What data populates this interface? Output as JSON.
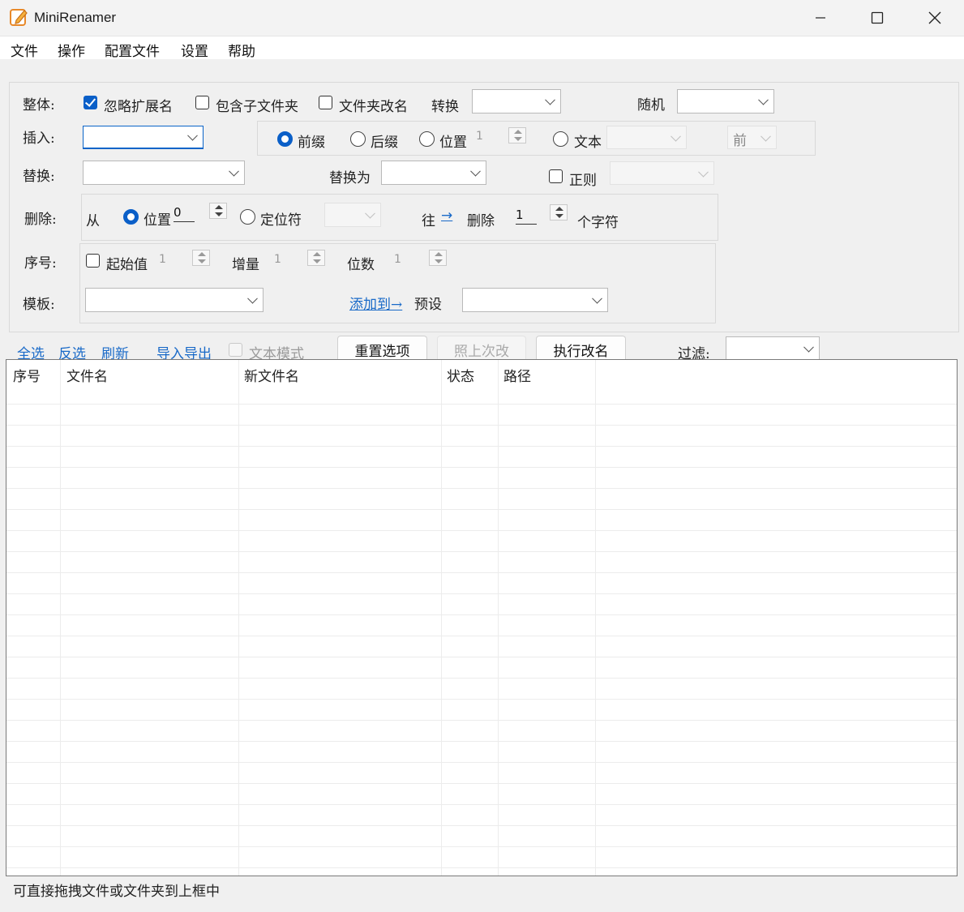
{
  "window": {
    "title": "MiniRenamer",
    "controls": [
      "minimize",
      "maximize",
      "close"
    ]
  },
  "menu": [
    "文件",
    "操作",
    "配置文件",
    "设置",
    "帮助"
  ],
  "options": {
    "whole": {
      "label": "整体:",
      "ignore_ext": {
        "label": "忽略扩展名",
        "checked": true
      },
      "include_subfolders": {
        "label": "包含子文件夹",
        "checked": false
      },
      "rename_folders": {
        "label": "文件夹改名",
        "checked": false
      },
      "convert_label": "转换",
      "convert_value": "",
      "random_label": "随机",
      "random_value": ""
    },
    "insert": {
      "label": "插入:",
      "value": "",
      "prefix_label": "前缀",
      "suffix_label": "后缀",
      "position_label": "位置",
      "position_value": "1",
      "text_label": "文本",
      "text_value": "",
      "side_value": "前",
      "selected": "prefix"
    },
    "replace": {
      "label": "替换:",
      "value": "",
      "replace_with_label": "替换为",
      "replace_with_value": "",
      "regex_label": "正则",
      "regex_checked": false,
      "regex_value": ""
    },
    "delete": {
      "label": "删除:",
      "from_label": "从",
      "position_label": "位置",
      "position_value": "0",
      "locator_label": "定位符",
      "locator_value": "",
      "direction_label": "往",
      "direction_arrow": "→",
      "delete_label": "删除",
      "count_value": "1",
      "chars_label": "个字符"
    },
    "sequence": {
      "label": "序号:",
      "start_label": "起始值",
      "start_checked": false,
      "start_value": "1",
      "increment_label": "增量",
      "increment_value": "1",
      "digits_label": "位数",
      "digits_value": "1"
    },
    "template": {
      "label": "模板:",
      "value": "",
      "add_to_label": "添加到→",
      "preset_label": "预设",
      "preset_value": ""
    }
  },
  "toolbar": {
    "select_all": "全选",
    "invert": "反选",
    "refresh": "刷新",
    "import_export": "导入导出",
    "text_mode": {
      "label": "文本模式",
      "checked": false
    },
    "reset": "重置选项",
    "repeat_last": "照上次改",
    "execute": "执行改名",
    "filter_label": "过滤:",
    "filter_value": ""
  },
  "table": {
    "columns": [
      "序号",
      "文件名",
      "新文件名",
      "状态",
      "路径"
    ],
    "rows": []
  },
  "status": "可直接拖拽文件或文件夹到上框中"
}
